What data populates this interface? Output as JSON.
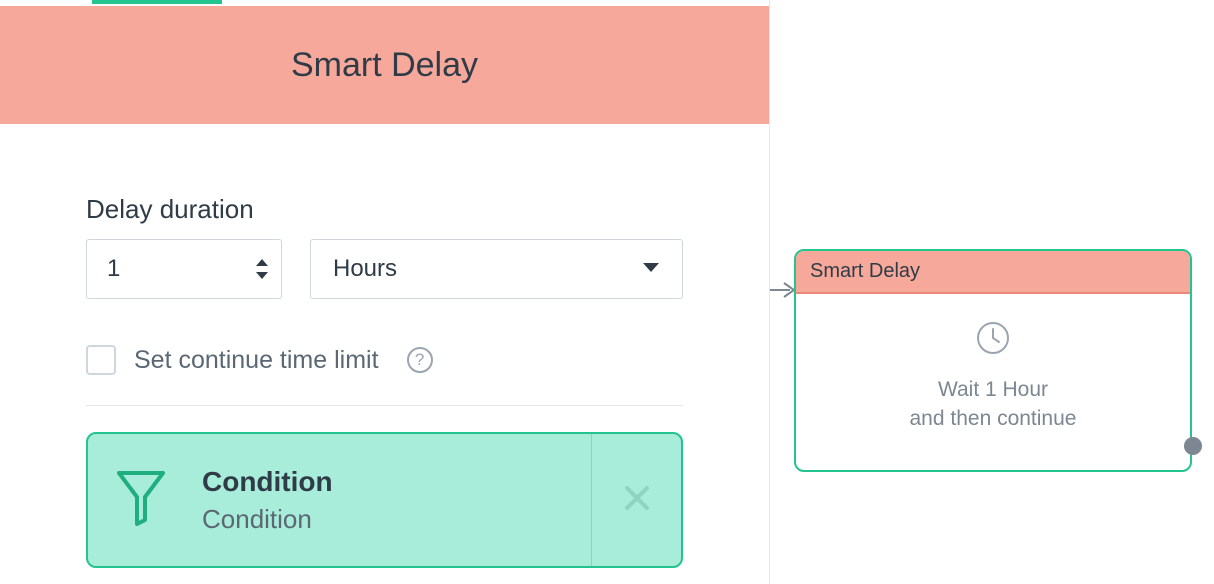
{
  "panel": {
    "title": "Smart Delay",
    "duration_label": "Delay duration",
    "duration_value": "1",
    "duration_unit": "Hours",
    "continue_label": "Set continue time limit",
    "condition": {
      "title": "Condition",
      "subtitle": "Condition"
    }
  },
  "node": {
    "title": "Smart Delay",
    "line1": "Wait 1 Hour",
    "line2": "and then continue"
  },
  "colors": {
    "accent_green": "#23c48e",
    "header_salmon": "#f6a89a",
    "mint": "#a7edd9"
  }
}
